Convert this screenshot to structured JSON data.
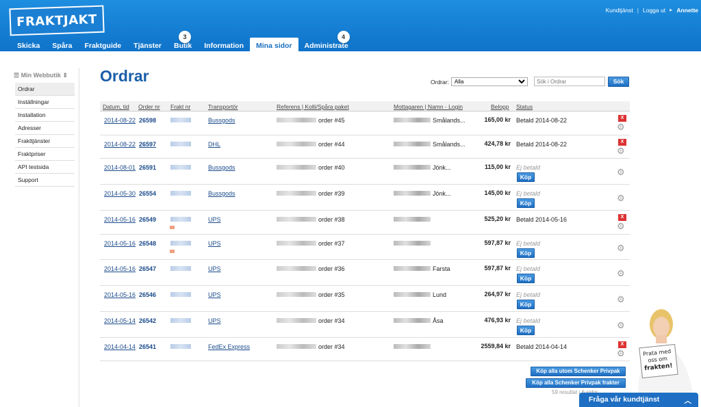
{
  "header": {
    "logo": "FRAKTJAKT",
    "links": {
      "kundtjanst": "Kundtjänst",
      "logout": "Logga ut",
      "user": "Annette"
    },
    "nav": [
      {
        "label": "Skicka"
      },
      {
        "label": "Spåra"
      },
      {
        "label": "Fraktguide"
      },
      {
        "label": "Tjänster"
      },
      {
        "label": "Butik",
        "badge": "3"
      },
      {
        "label": "Information"
      },
      {
        "label": "Mina sidor"
      },
      {
        "label": "Administrate",
        "badge": "4"
      }
    ]
  },
  "sidebar": {
    "title": "Min Webbutik",
    "items": [
      "Ordrar",
      "Inställningar",
      "Installation",
      "Adresser",
      "Frakttjänster",
      "Fraktpriser",
      "API testsida",
      "Support"
    ]
  },
  "page": {
    "title": "Ordrar",
    "filter_label": "Ordrar:",
    "filter_value": "Alla",
    "search_placeholder": "Sök i Ordrar",
    "search_button": "Sök"
  },
  "table": {
    "headers": {
      "date": "Datum, tid",
      "order": "Order nr",
      "frakt": "Frakt nr",
      "carrier": "Transportör",
      "ref": "Referens | Kolli/Spåra paket",
      "recipient": "Mottagaren | Namn - Login",
      "amount": "Belopp",
      "status": "Status"
    },
    "buy_label": "Köp",
    "rows": [
      {
        "date": "2014-08-22",
        "order": "26598",
        "carrier": "Bussgods",
        "ref": "order #45",
        "recipient": "Smålands...",
        "amount": "165,00 kr",
        "status": "Betald 2014-08-22",
        "paid": true
      },
      {
        "date": "2014-08-22",
        "order": "26597",
        "carrier": "DHL",
        "ref": "order #44",
        "recipient": "Smålands...",
        "amount": "424,78 kr",
        "status": "Betald 2014-08-22",
        "paid": true
      },
      {
        "date": "2014-08-01",
        "order": "26591",
        "carrier": "Bussgods",
        "ref": "order #40",
        "recipient": "Jönk...",
        "amount": "115,00 kr",
        "status": "Ej betald",
        "paid": false
      },
      {
        "date": "2014-05-30",
        "order": "26554",
        "carrier": "Bussgods",
        "ref": "order #39",
        "recipient": "Jönk...",
        "amount": "145,00 kr",
        "status": "Ej betald",
        "paid": false
      },
      {
        "date": "2014-05-16",
        "order": "26549",
        "carrier": "UPS",
        "ref": "order #38",
        "recipient": "",
        "amount": "525,20 kr",
        "status": "Betald 2014-05-16",
        "paid": true
      },
      {
        "date": "2014-05-16",
        "order": "26548",
        "carrier": "UPS",
        "ref": "order #37",
        "recipient": "",
        "amount": "597,87 kr",
        "status": "Ej betald",
        "paid": false
      },
      {
        "date": "2014-05-16",
        "order": "26547",
        "carrier": "UPS",
        "ref": "order #36",
        "recipient": "Farsta",
        "amount": "597,87 kr",
        "status": "Ej betald",
        "paid": false
      },
      {
        "date": "2014-05-16",
        "order": "26546",
        "carrier": "UPS",
        "ref": "order #35",
        "recipient": "Lund",
        "amount": "264,97 kr",
        "status": "Ej betald",
        "paid": false
      },
      {
        "date": "2014-05-14",
        "order": "26542",
        "carrier": "UPS",
        "ref": "order #34",
        "recipient": "Åsa",
        "amount": "476,93 kr",
        "status": "Ej betald",
        "paid": false
      },
      {
        "date": "2014-04-14",
        "order": "26541",
        "carrier": "FedEx Express",
        "ref": "order #34",
        "recipient": "",
        "amount": "2559,84 kr",
        "status": "Betald 2014-04-14",
        "paid": true
      }
    ]
  },
  "bottom": {
    "buy_all_except": "Köp alla utom Schenker Privpak",
    "buy_all_schenker": "Köp alla Schenker Privpak frakter",
    "results": "59 resultat i 6 sidor"
  },
  "chat": {
    "label": "Fråga vår kundtjänst",
    "sign": "Prata med oss om frakten!"
  },
  "colors": {
    "header_blue": "#1177d1",
    "title_blue": "#1a5ea8",
    "cancel_red": "#d33"
  }
}
